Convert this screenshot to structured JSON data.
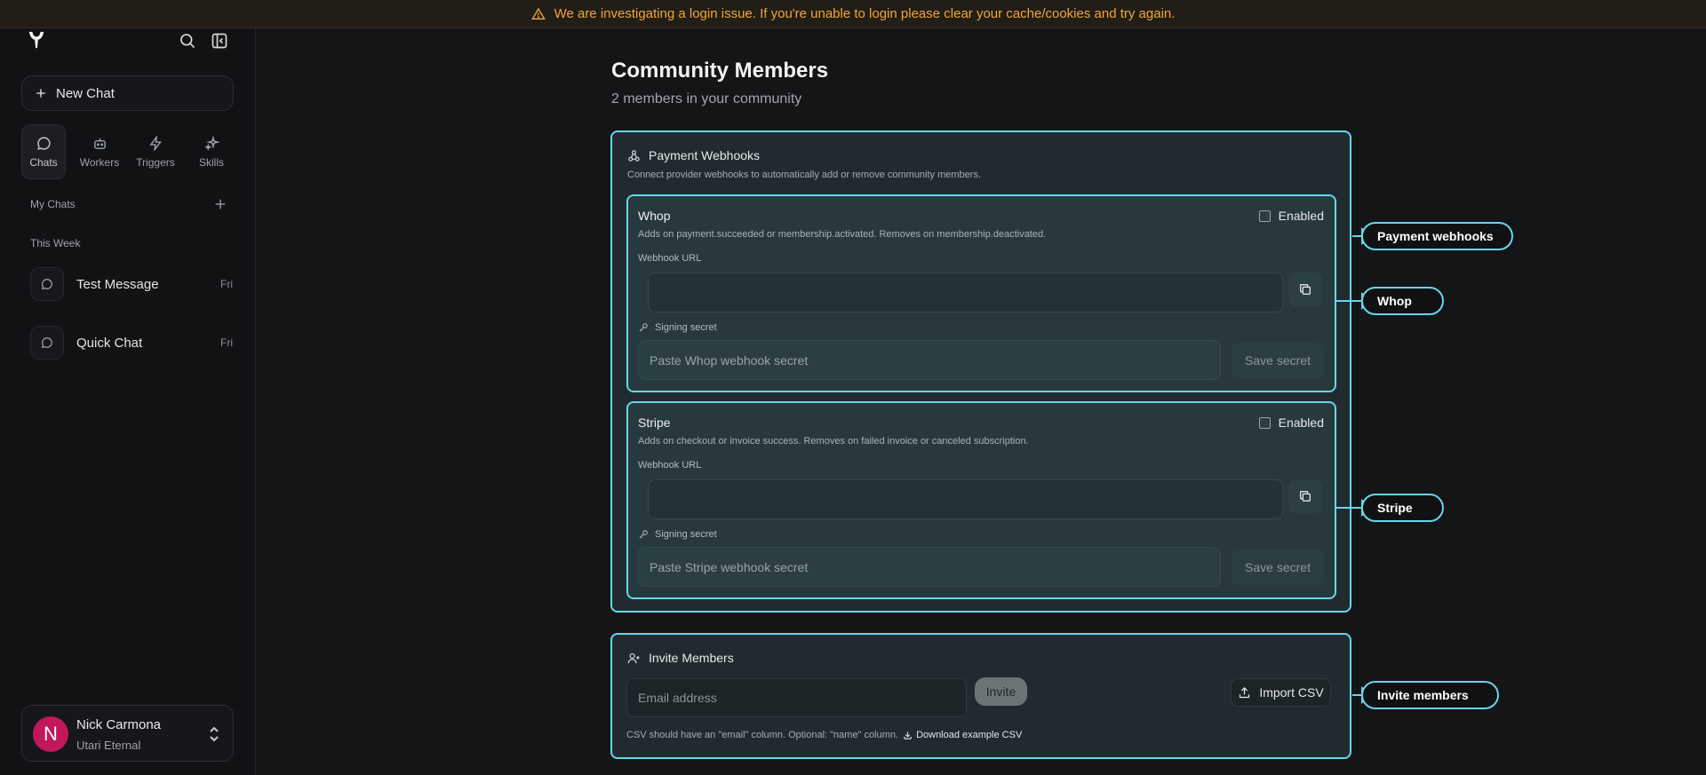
{
  "banner": {
    "text": "We are investigating a login issue. If you're unable to login please clear your cache/cookies and try again."
  },
  "sidebar": {
    "new_chat": "New Chat",
    "tabs": [
      {
        "label": "Chats",
        "icon": "chat-bubble-icon"
      },
      {
        "label": "Workers",
        "icon": "robot-icon"
      },
      {
        "label": "Triggers",
        "icon": "lightning-icon"
      },
      {
        "label": "Skills",
        "icon": "sparkles-icon"
      }
    ],
    "my_chats": "My Chats",
    "this_week": "This Week",
    "chats": [
      {
        "title": "Test Message",
        "date": "Fri"
      },
      {
        "title": "Quick Chat",
        "date": "Fri"
      }
    ],
    "user": {
      "initial": "N",
      "name": "Nick Carmona",
      "org": "Utari Eternal"
    }
  },
  "main": {
    "title": "Community Members",
    "subtitle": "2 members in your community",
    "webhooks": {
      "title": "Payment Webhooks",
      "description": "Connect provider webhooks to automatically add or remove community members.",
      "providers": [
        {
          "name": "Whop",
          "description": "Adds on payment.succeeded or membership.activated. Removes on membership.deactivated.",
          "enabled_label": "Enabled",
          "url_label": "Webhook URL",
          "secret_label": "Signing secret",
          "secret_placeholder": "Paste Whop webhook secret",
          "save_label": "Save secret"
        },
        {
          "name": "Stripe",
          "description": "Adds on checkout or invoice success. Removes on failed invoice or canceled subscription.",
          "enabled_label": "Enabled",
          "url_label": "Webhook URL",
          "secret_label": "Signing secret",
          "secret_placeholder": "Paste Stripe webhook secret",
          "save_label": "Save secret"
        }
      ]
    },
    "invite": {
      "title": "Invite Members",
      "email_placeholder": "Email address",
      "invite_label": "Invite",
      "import_label": "Import CSV",
      "csv_note": "CSV should have an \"email\" column. Optional: \"name\" column.",
      "download_label": "Download example CSV"
    }
  },
  "annotations": {
    "payment_webhooks": "Payment webhooks",
    "whop": "Whop",
    "stripe": "Stripe",
    "invite_members": "Invite members"
  },
  "colors": {
    "accent": "#67d6ec",
    "banner_text": "#f0a53b",
    "avatar": "#c2185b"
  }
}
